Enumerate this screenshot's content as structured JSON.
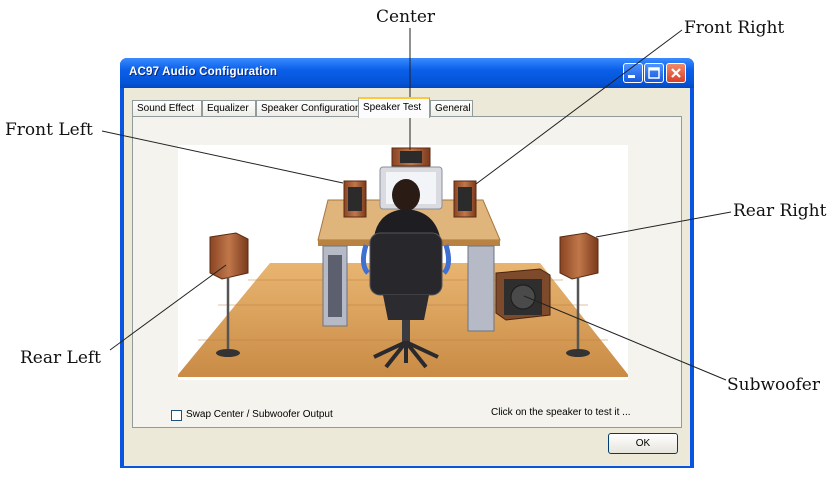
{
  "window": {
    "title": "AC97 Audio Configuration"
  },
  "tabs": [
    {
      "label": "Sound Effect"
    },
    {
      "label": "Equalizer"
    },
    {
      "label": "Speaker Configuration"
    },
    {
      "label": "Speaker Test",
      "active": true
    },
    {
      "label": "General"
    }
  ],
  "callouts": {
    "center": "Center",
    "front_right": "Front Right",
    "front_left": "Front Left",
    "rear_right": "Rear Right",
    "rear_left": "Rear Left",
    "subwoofer": "Subwoofer"
  },
  "options": {
    "swap_label": "Swap Center / Subwoofer Output",
    "swap_checked": false
  },
  "hint": "Click on the speaker to test it ...",
  "buttons": {
    "ok": "OK"
  },
  "colors": {
    "titlebar": "#0a5fe8",
    "dialog": "#ece9d8",
    "floor": "#d9a060",
    "speaker": "#b2643a"
  }
}
